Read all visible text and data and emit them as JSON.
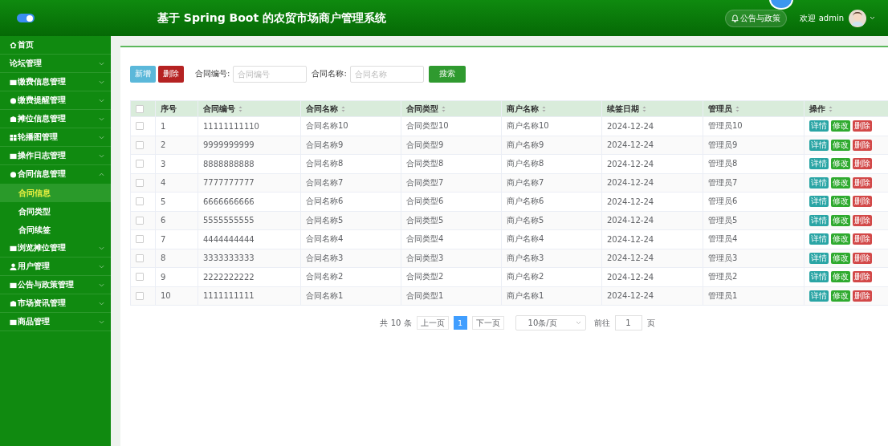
{
  "header": {
    "title": "基于 Spring Boot 的农贸市场商户管理系统",
    "notice_button": "公告与政策",
    "welcome": "欢迎 admin",
    "sidebar_toggle": {
      "on": true
    }
  },
  "sidebar": {
    "items": [
      {
        "label": "首页"
      },
      {
        "label": "论坛管理",
        "expanded": false
      },
      {
        "label": "缴费信息管理",
        "expanded": false
      },
      {
        "label": "缴费提醒管理",
        "expanded": false
      },
      {
        "label": "摊位信息管理",
        "expanded": false
      },
      {
        "label": "轮播图管理",
        "expanded": false
      },
      {
        "label": "操作日志管理",
        "expanded": false
      },
      {
        "label": "合同信息管理",
        "expanded": true,
        "children": [
          {
            "label": "合同信息",
            "selected": true
          },
          {
            "label": "合同类型",
            "selected": false
          },
          {
            "label": "合同续签",
            "selected": false
          }
        ]
      },
      {
        "label": "浏览摊位管理",
        "expanded": false
      },
      {
        "label": "用户管理",
        "expanded": false
      },
      {
        "label": "公告与政策管理",
        "expanded": false
      },
      {
        "label": "市场资讯管理",
        "expanded": false
      },
      {
        "label": "商品管理",
        "expanded": false
      }
    ]
  },
  "toolbar": {
    "add_button": "新增",
    "delete_button": "删除",
    "filters": [
      {
        "label": "合同编号:",
        "placeholder": "合同编号"
      },
      {
        "label": "合同名称:",
        "placeholder": "合同名称"
      }
    ],
    "search_button": "搜索"
  },
  "table": {
    "all_checked": false,
    "columns": [
      {
        "label": "序号",
        "sortable": false
      },
      {
        "label": "合同编号",
        "sortable": true
      },
      {
        "label": "合同名称",
        "sortable": true
      },
      {
        "label": "合同类型",
        "sortable": true
      },
      {
        "label": "商户名称",
        "sortable": true
      },
      {
        "label": "续签日期",
        "sortable": true
      },
      {
        "label": "管理员",
        "sortable": true
      },
      {
        "label": "操作",
        "sortable": true
      }
    ],
    "rows": [
      {
        "checked": false,
        "cells": [
          "1",
          "11111111110",
          "合同名称10",
          "合同类型10",
          "商户名称10",
          "2024-12-24",
          "管理员10"
        ],
        "actions": [
          {
            "label": "详情",
            "kind": "detail"
          },
          {
            "label": "修改",
            "kind": "edit"
          },
          {
            "label": "删除",
            "kind": "delete"
          }
        ]
      },
      {
        "checked": false,
        "cells": [
          "2",
          "9999999999",
          "合同名称9",
          "合同类型9",
          "商户名称9",
          "2024-12-24",
          "管理员9"
        ],
        "actions": [
          {
            "label": "详情",
            "kind": "detail"
          },
          {
            "label": "修改",
            "kind": "edit"
          },
          {
            "label": "删除",
            "kind": "delete"
          }
        ]
      },
      {
        "checked": false,
        "cells": [
          "3",
          "8888888888",
          "合同名称8",
          "合同类型8",
          "商户名称8",
          "2024-12-24",
          "管理员8"
        ],
        "actions": [
          {
            "label": "详情",
            "kind": "detail"
          },
          {
            "label": "修改",
            "kind": "edit"
          },
          {
            "label": "删除",
            "kind": "delete"
          }
        ]
      },
      {
        "checked": false,
        "cells": [
          "4",
          "7777777777",
          "合同名称7",
          "合同类型7",
          "商户名称7",
          "2024-12-24",
          "管理员7"
        ],
        "actions": [
          {
            "label": "详情",
            "kind": "detail"
          },
          {
            "label": "修改",
            "kind": "edit"
          },
          {
            "label": "删除",
            "kind": "delete"
          }
        ]
      },
      {
        "checked": false,
        "cells": [
          "5",
          "6666666666",
          "合同名称6",
          "合同类型6",
          "商户名称6",
          "2024-12-24",
          "管理员6"
        ],
        "actions": [
          {
            "label": "详情",
            "kind": "detail"
          },
          {
            "label": "修改",
            "kind": "edit"
          },
          {
            "label": "删除",
            "kind": "delete"
          }
        ]
      },
      {
        "checked": false,
        "cells": [
          "6",
          "5555555555",
          "合同名称5",
          "合同类型5",
          "商户名称5",
          "2024-12-24",
          "管理员5"
        ],
        "actions": [
          {
            "label": "详情",
            "kind": "detail"
          },
          {
            "label": "修改",
            "kind": "edit"
          },
          {
            "label": "删除",
            "kind": "delete"
          }
        ]
      },
      {
        "checked": false,
        "cells": [
          "7",
          "4444444444",
          "合同名称4",
          "合同类型4",
          "商户名称4",
          "2024-12-24",
          "管理员4"
        ],
        "actions": [
          {
            "label": "详情",
            "kind": "detail"
          },
          {
            "label": "修改",
            "kind": "edit"
          },
          {
            "label": "删除",
            "kind": "delete"
          }
        ]
      },
      {
        "checked": false,
        "cells": [
          "8",
          "3333333333",
          "合同名称3",
          "合同类型3",
          "商户名称3",
          "2024-12-24",
          "管理员3"
        ],
        "actions": [
          {
            "label": "详情",
            "kind": "detail"
          },
          {
            "label": "修改",
            "kind": "edit"
          },
          {
            "label": "删除",
            "kind": "delete"
          }
        ]
      },
      {
        "checked": false,
        "cells": [
          "9",
          "2222222222",
          "合同名称2",
          "合同类型2",
          "商户名称2",
          "2024-12-24",
          "管理员2"
        ],
        "actions": [
          {
            "label": "详情",
            "kind": "detail"
          },
          {
            "label": "修改",
            "kind": "edit"
          },
          {
            "label": "删除",
            "kind": "delete"
          }
        ]
      },
      {
        "checked": false,
        "cells": [
          "10",
          "1111111111",
          "合同名称1",
          "合同类型1",
          "商户名称1",
          "2024-12-24",
          "管理员1"
        ],
        "actions": [
          {
            "label": "详情",
            "kind": "detail"
          },
          {
            "label": "修改",
            "kind": "edit"
          },
          {
            "label": "删除",
            "kind": "delete"
          }
        ]
      }
    ]
  },
  "pagination": {
    "total": "共 10 条",
    "prev": "上一页",
    "pages": [
      {
        "label": "1",
        "selected": true
      }
    ],
    "next": "下一页",
    "page_size": "10条/页",
    "goto_label": "前往",
    "goto_value": "1",
    "goto_suffix": "页"
  }
}
